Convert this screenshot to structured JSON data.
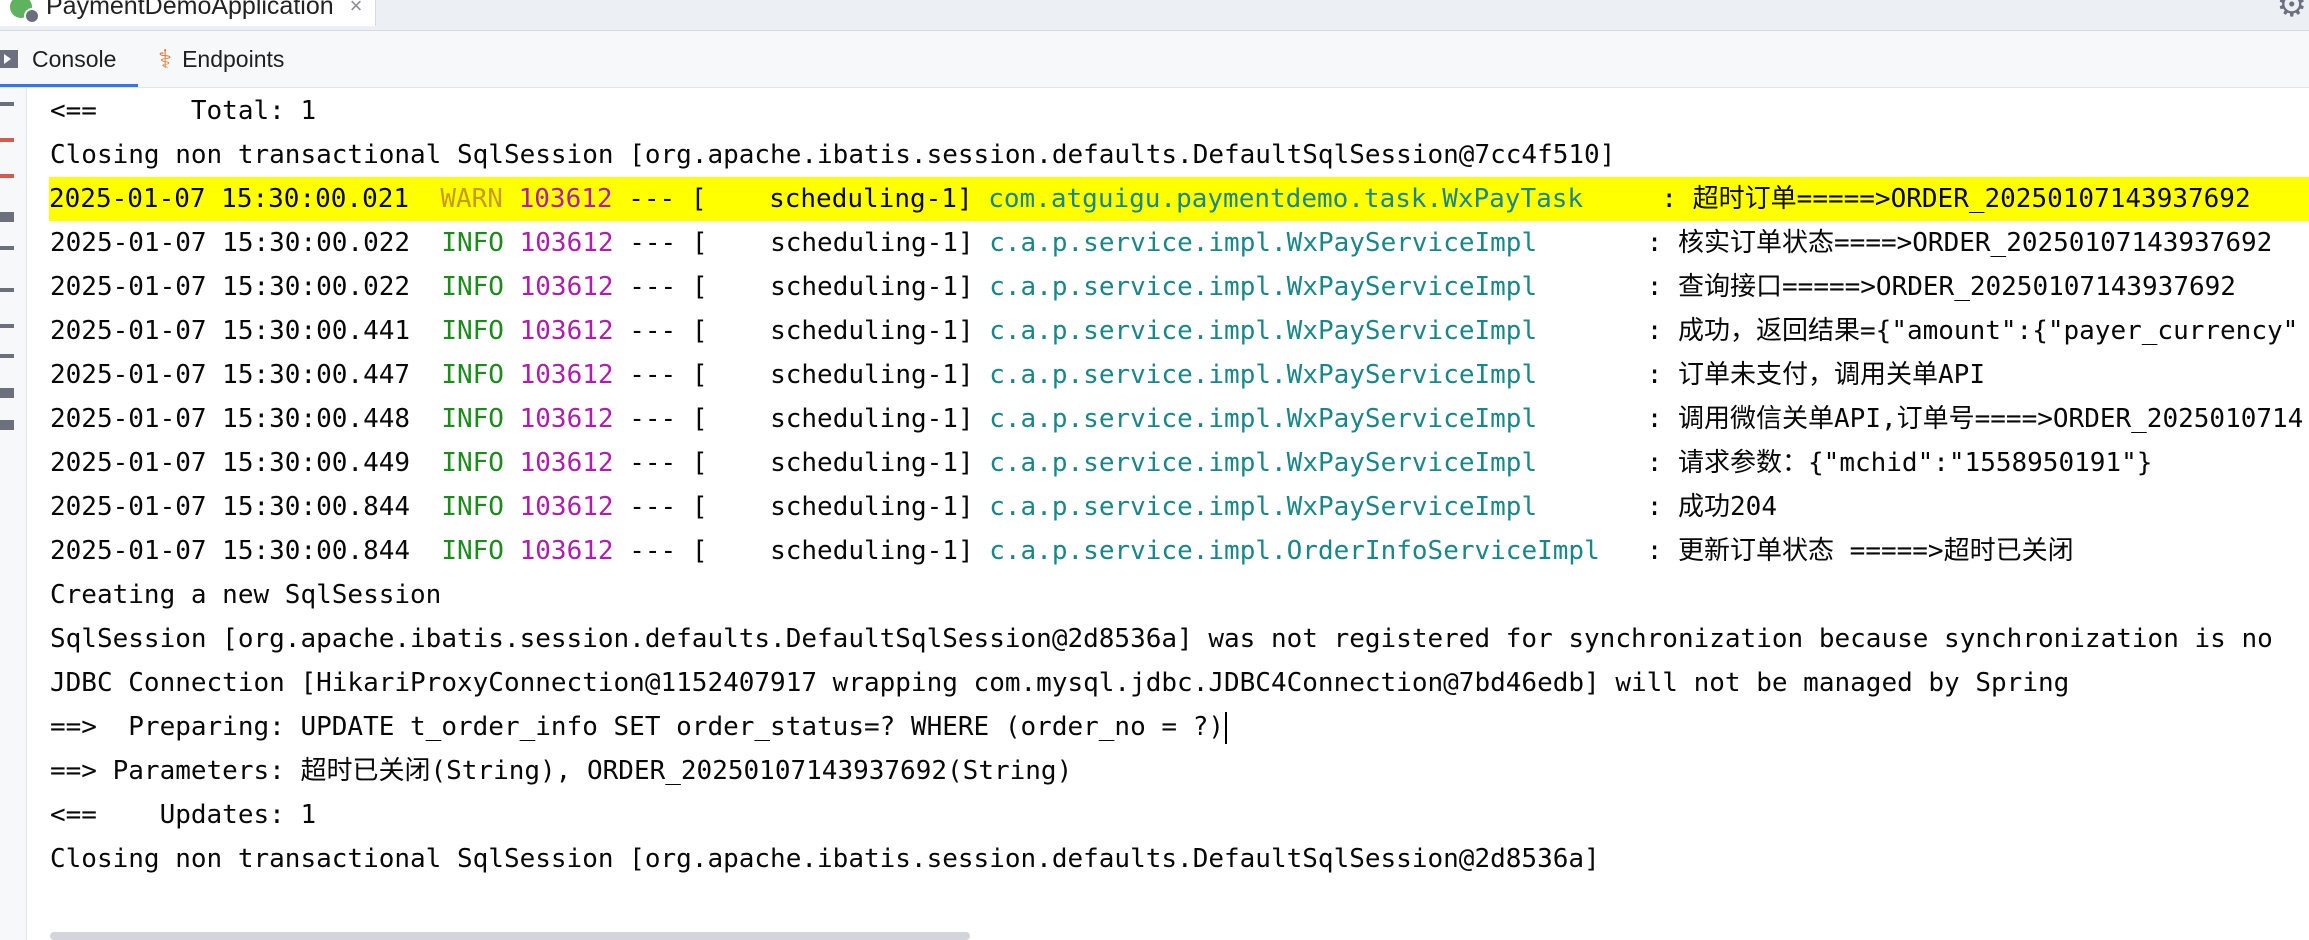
{
  "run_tab": {
    "title": "PaymentDemoApplication",
    "close": "×",
    "icon": "spring-boot-app-icon"
  },
  "settings_icon": "⚙",
  "tool_tabs": {
    "console": "Console",
    "endpoints": "Endpoints"
  },
  "colors": {
    "warn_highlight": "#ffff00",
    "warn": "#c89a19",
    "info": "#1a8c1a",
    "pid": "#b01cb0",
    "logger": "#18878a",
    "active_tab": "#3574f0"
  },
  "console": {
    "lines": [
      {
        "text": "<==      Total: 1"
      },
      {
        "text": "Closing non transactional SqlSession [org.apache.ibatis.session.defaults.DefaultSqlSession@7cc4f510]"
      },
      {
        "ts": "2025-01-07 15:30:00.021",
        "level": "WARN",
        "pid": "103612",
        "sep": "--- [",
        "thread": "   scheduling-1]",
        "logger": "com.atguigu.paymentdemo.task.WxPayTask    ",
        "msg": " : 超时订单=====>ORDER_20250107143937692",
        "highlight": true
      },
      {
        "ts": "2025-01-07 15:30:00.022",
        "level": "INFO",
        "pid": "103612",
        "sep": "--- [",
        "thread": "   scheduling-1]",
        "logger": "c.a.p.service.impl.WxPayServiceImpl      ",
        "msg": " : 核实订单状态====>ORDER_20250107143937692"
      },
      {
        "ts": "2025-01-07 15:30:00.022",
        "level": "INFO",
        "pid": "103612",
        "sep": "--- [",
        "thread": "   scheduling-1]",
        "logger": "c.a.p.service.impl.WxPayServiceImpl      ",
        "msg": " : 查询接口=====>ORDER_20250107143937692"
      },
      {
        "ts": "2025-01-07 15:30:00.441",
        "level": "INFO",
        "pid": "103612",
        "sep": "--- [",
        "thread": "   scheduling-1]",
        "logger": "c.a.p.service.impl.WxPayServiceImpl      ",
        "msg": " : 成功，返回结果={\"amount\":{\"payer_currency\""
      },
      {
        "ts": "2025-01-07 15:30:00.447",
        "level": "INFO",
        "pid": "103612",
        "sep": "--- [",
        "thread": "   scheduling-1]",
        "logger": "c.a.p.service.impl.WxPayServiceImpl      ",
        "msg": " : 订单未支付，调用关单API"
      },
      {
        "ts": "2025-01-07 15:30:00.448",
        "level": "INFO",
        "pid": "103612",
        "sep": "--- [",
        "thread": "   scheduling-1]",
        "logger": "c.a.p.service.impl.WxPayServiceImpl      ",
        "msg": " : 调用微信关单API,订单号====>ORDER_2025010714"
      },
      {
        "ts": "2025-01-07 15:30:00.449",
        "level": "INFO",
        "pid": "103612",
        "sep": "--- [",
        "thread": "   scheduling-1]",
        "logger": "c.a.p.service.impl.WxPayServiceImpl      ",
        "msg": " : 请求参数：{\"mchid\":\"1558950191\"}"
      },
      {
        "ts": "2025-01-07 15:30:00.844",
        "level": "INFO",
        "pid": "103612",
        "sep": "--- [",
        "thread": "   scheduling-1]",
        "logger": "c.a.p.service.impl.WxPayServiceImpl      ",
        "msg": " : 成功204"
      },
      {
        "ts": "2025-01-07 15:30:00.844",
        "level": "INFO",
        "pid": "103612",
        "sep": "--- [",
        "thread": "   scheduling-1]",
        "logger": "c.a.p.service.impl.OrderInfoServiceImpl  ",
        "msg": " : 更新订单状态 =====>超时已关闭"
      },
      {
        "text": "Creating a new SqlSession"
      },
      {
        "text": "SqlSession [org.apache.ibatis.session.defaults.DefaultSqlSession@2d8536a] was not registered for synchronization because synchronization is no"
      },
      {
        "text": "JDBC Connection [HikariProxyConnection@1152407917 wrapping com.mysql.jdbc.JDBC4Connection@7bd46edb] will not be managed by Spring"
      },
      {
        "text": "==>  Preparing: UPDATE t_order_info SET order_status=? WHERE (order_no = ?)",
        "caret": true
      },
      {
        "text": "==> Parameters: 超时已关闭(String), ORDER_20250107143937692(String)"
      },
      {
        "text": "<==    Updates: 1"
      },
      {
        "text": "Closing non transactional SqlSession [org.apache.ibatis.session.defaults.DefaultSqlSession@2d8536a]"
      }
    ]
  }
}
